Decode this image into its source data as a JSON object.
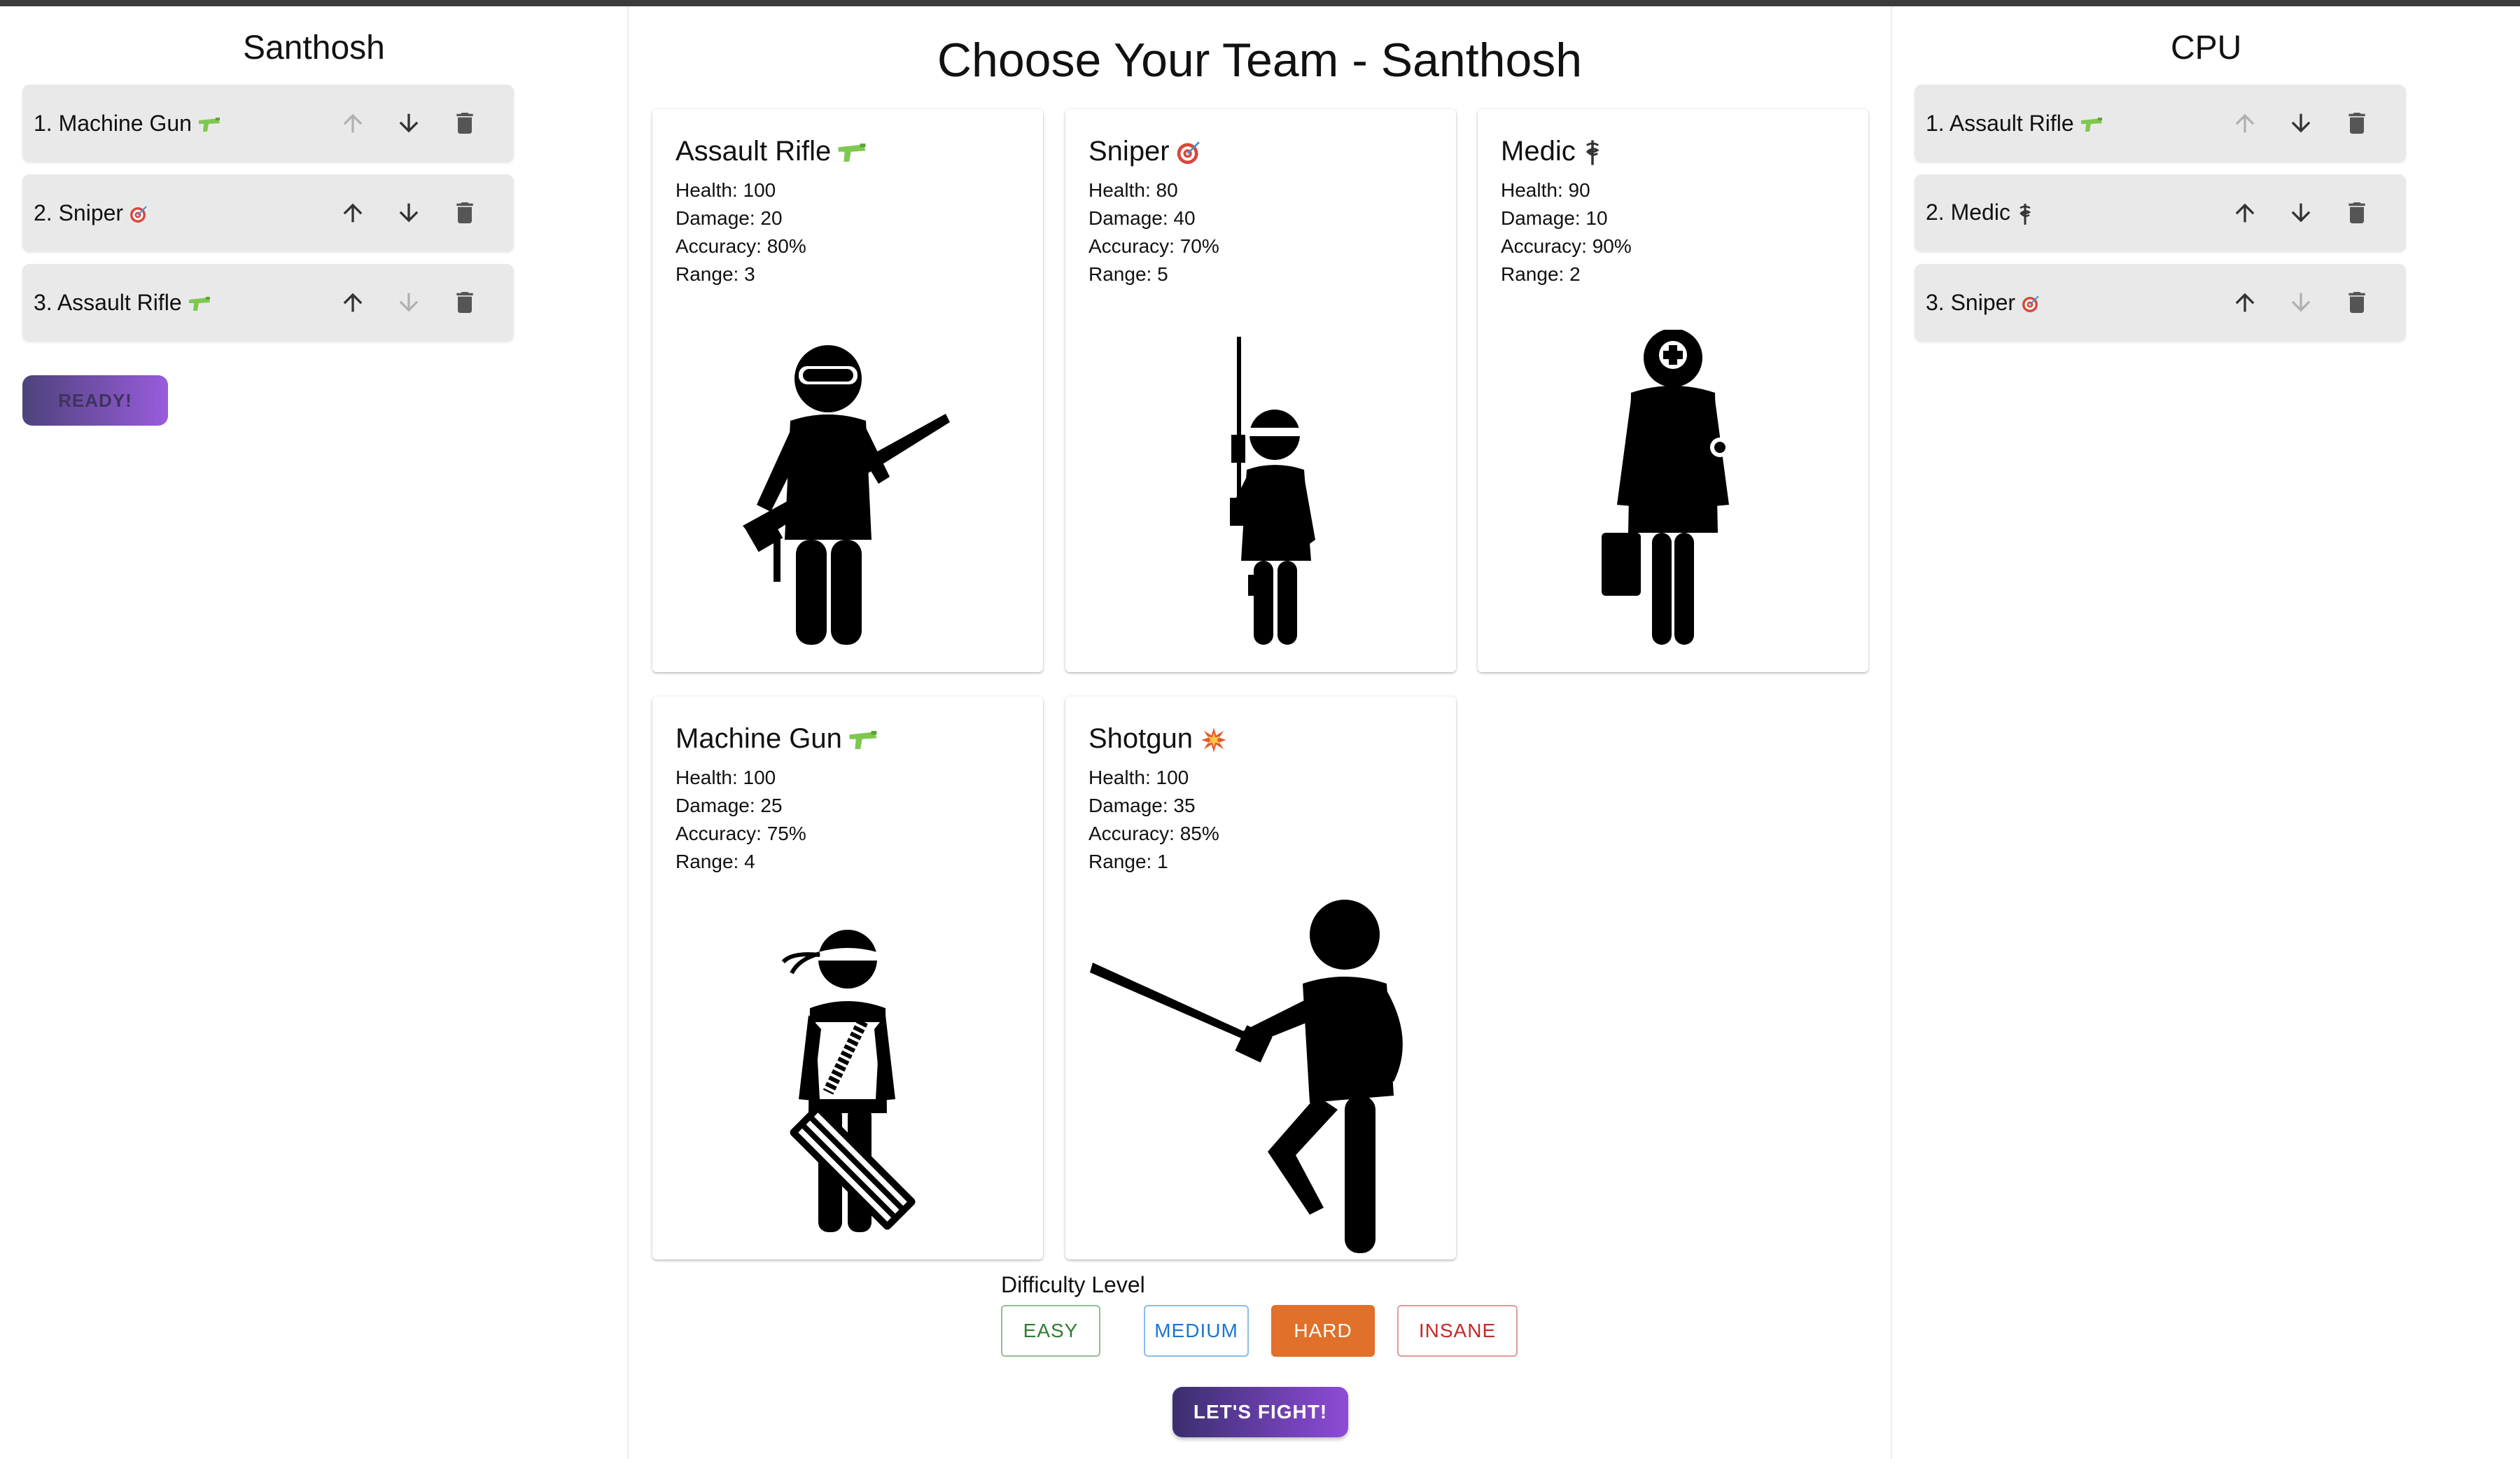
{
  "player": {
    "name": "Santhosh",
    "team": [
      {
        "label": "1. Machine Gun",
        "icon": "water-pistol-icon",
        "up_disabled": true,
        "down_disabled": false
      },
      {
        "label": "2. Sniper",
        "icon": "target-icon",
        "up_disabled": false,
        "down_disabled": false
      },
      {
        "label": "3. Assault Rifle",
        "icon": "water-pistol-icon",
        "up_disabled": false,
        "down_disabled": true
      }
    ],
    "ready_label": "READY!"
  },
  "cpu": {
    "name": "CPU",
    "team": [
      {
        "label": "1. Assault Rifle",
        "icon": "water-pistol-icon",
        "up_disabled": true,
        "down_disabled": false
      },
      {
        "label": "2. Medic",
        "icon": "medical-symbol-icon",
        "up_disabled": false,
        "down_disabled": false
      },
      {
        "label": "3. Sniper",
        "icon": "target-icon",
        "up_disabled": false,
        "down_disabled": true
      }
    ]
  },
  "main": {
    "title": "Choose Your Team - Santhosh",
    "units": [
      {
        "name": "Assault Rifle",
        "icon": "water-pistol-icon",
        "health": "Health: 100",
        "damage": "Damage: 20",
        "accuracy": "Accuracy: 80%",
        "range": "Range: 3",
        "figure": "assault-rifle-soldier-figure"
      },
      {
        "name": "Sniper",
        "icon": "target-icon",
        "health": "Health: 80",
        "damage": "Damage: 40",
        "accuracy": "Accuracy: 70%",
        "range": "Range: 5",
        "figure": "sniper-soldier-figure"
      },
      {
        "name": "Medic",
        "icon": "medical-symbol-icon",
        "health": "Health: 90",
        "damage": "Damage: 10",
        "accuracy": "Accuracy: 90%",
        "range": "Range: 2",
        "figure": "medic-soldier-figure"
      },
      {
        "name": "Machine Gun",
        "icon": "water-pistol-icon",
        "health": "Health: 100",
        "damage": "Damage: 25",
        "accuracy": "Accuracy: 75%",
        "range": "Range: 4",
        "figure": "machine-gun-soldier-figure"
      },
      {
        "name": "Shotgun",
        "icon": "collision-icon",
        "health": "Health: 100",
        "damage": "Damage: 35",
        "accuracy": "Accuracy: 85%",
        "range": "Range: 1",
        "figure": "shotgun-soldier-figure"
      }
    ],
    "difficulty": {
      "label": "Difficulty Level",
      "options": [
        {
          "label": "EASY",
          "color": "#2e7d32",
          "selected": false
        },
        {
          "label": "MEDIUM",
          "color": "#1976d2",
          "selected": false
        },
        {
          "label": "HARD",
          "color": "#e0702a",
          "selected": true
        },
        {
          "label": "INSANE",
          "color": "#c62828",
          "selected": false
        }
      ]
    },
    "fight_label": "LET'S FIGHT!"
  },
  "colors": {
    "button_gradient_start": "#3a2f6e",
    "button_gradient_end": "#8e4bd8",
    "list_item_bg": "#e9e9e9"
  }
}
